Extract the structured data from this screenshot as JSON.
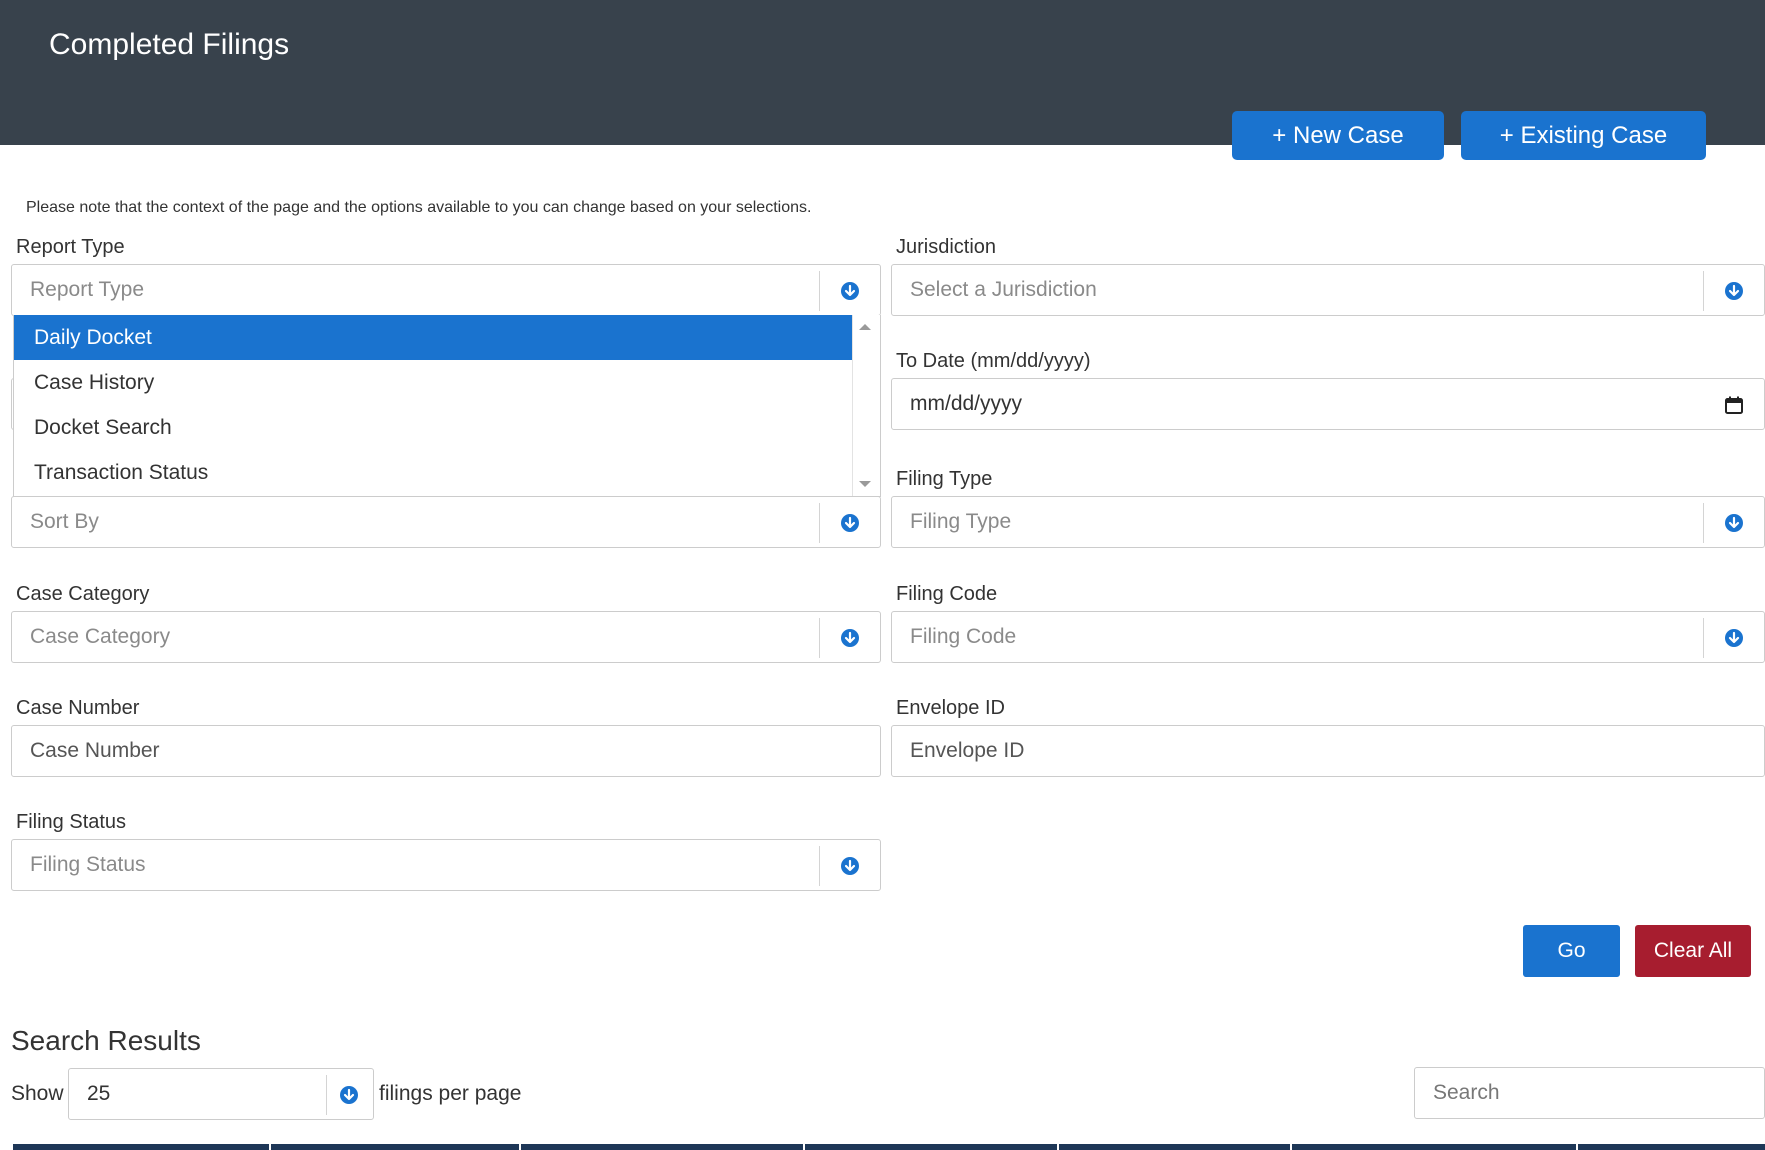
{
  "header": {
    "title": "Completed Filings",
    "new_case_label": "+ New Case",
    "existing_case_label": "+ Existing Case"
  },
  "note": "Please note that the context of the page and the options available to you can change based on your selections.",
  "form": {
    "report_type": {
      "label": "Report Type",
      "placeholder": "Report Type",
      "options": [
        "Daily Docket",
        "Case History",
        "Docket Search",
        "Transaction Status"
      ],
      "highlighted": "Daily Docket"
    },
    "jurisdiction": {
      "label": "Jurisdiction",
      "placeholder": "Select a Jurisdiction"
    },
    "to_date": {
      "label": "To Date (mm/dd/yyyy)",
      "placeholder": "mm/dd/yyyy"
    },
    "sort_by": {
      "placeholder": "Sort By"
    },
    "filing_type": {
      "label": "Filing Type",
      "placeholder": "Filing Type"
    },
    "case_category": {
      "label": "Case Category",
      "placeholder": "Case Category"
    },
    "filing_code": {
      "label": "Filing Code",
      "placeholder": "Filing Code"
    },
    "case_number": {
      "label": "Case Number",
      "placeholder": "Case Number"
    },
    "envelope_id": {
      "label": "Envelope ID",
      "placeholder": "Envelope ID"
    },
    "filing_status": {
      "label": "Filing Status",
      "placeholder": "Filing Status"
    }
  },
  "actions": {
    "go_label": "Go",
    "clear_label": "Clear All"
  },
  "results": {
    "title": "Search Results",
    "show_label": "Show",
    "page_size": "25",
    "per_page_label": "filings per page",
    "search_placeholder": "Search"
  },
  "colors": {
    "header_bg": "#38424c",
    "primary": "#1a73cf",
    "danger": "#a71d2f",
    "table_header": "#1e3757"
  },
  "icons": {
    "dropdown": "circle-arrow-down-icon",
    "calendar": "calendar-icon"
  }
}
